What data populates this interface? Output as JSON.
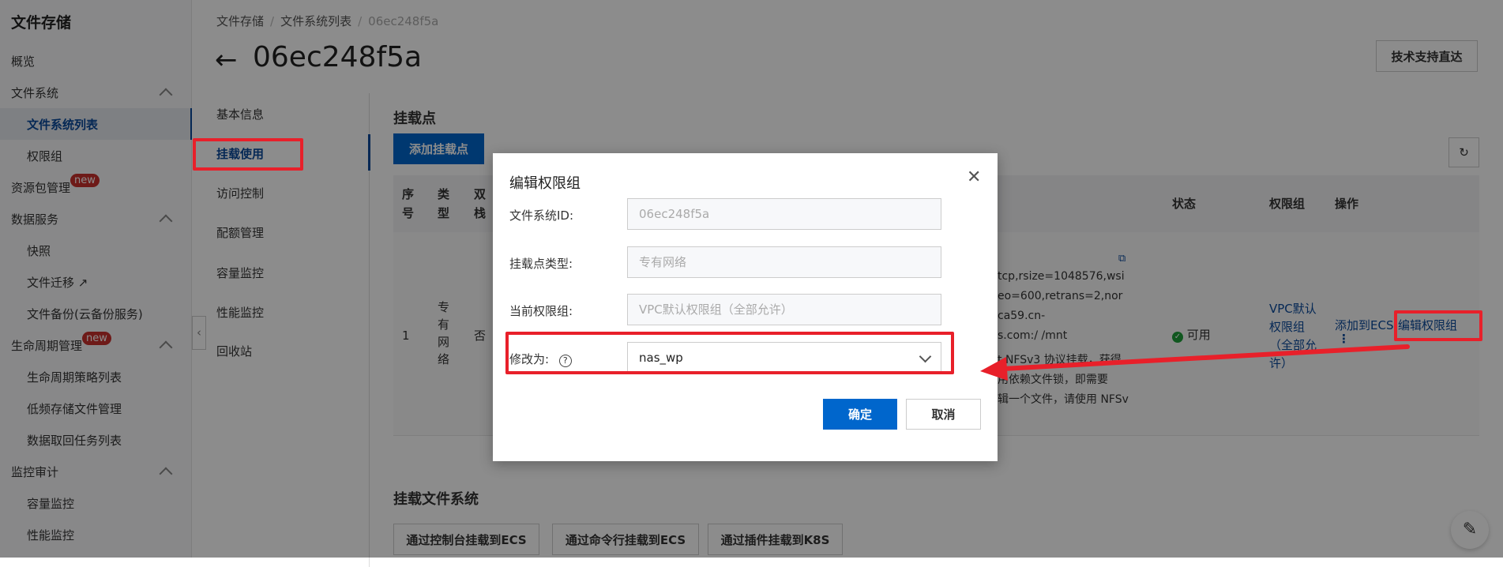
{
  "sidebar": {
    "title": "文件存储",
    "items": [
      {
        "label": "概览"
      },
      {
        "label": "文件系统"
      },
      {
        "label": "文件系统列表"
      },
      {
        "label": "权限组"
      },
      {
        "label": "资源包管理",
        "badge": "new"
      },
      {
        "label": "数据服务"
      },
      {
        "label": "快照"
      },
      {
        "label": "文件迁移"
      },
      {
        "label": "文件备份(云备份服务)"
      },
      {
        "label": "生命周期管理",
        "badge": "new"
      },
      {
        "label": "生命周期策略列表"
      },
      {
        "label": "低频存储文件管理"
      },
      {
        "label": "数据取回任务列表"
      },
      {
        "label": "监控审计"
      },
      {
        "label": "容量监控"
      },
      {
        "label": "性能监控"
      }
    ]
  },
  "breadcrumb": [
    "文件存储",
    "文件系统列表",
    "06ec248f5a"
  ],
  "header": {
    "title": "06ec248f5a",
    "support_button": "技术支持直达"
  },
  "subnav": [
    "基本信息",
    "挂载使用",
    "访问控制",
    "配额管理",
    "容量监控",
    "性能监控",
    "回收站"
  ],
  "mount": {
    "section_title": "挂载点",
    "add_button": "添加挂载点",
    "columns": [
      "序号",
      "类型",
      "双栈",
      "状态",
      "权限组",
      "操作"
    ],
    "row": {
      "index": "1",
      "type": "专有网络",
      "dual_stack": "否",
      "command_lines": [
        "tcp,rsize=1048576,wsi",
        "eo=600,retrans=2,nor",
        "ca59.cn-",
        "s.com:/ /mnt"
      ],
      "note_lines": [
        "t NFSv3 协议挂载，获得",
        "用依赖文件锁，即需要",
        "辑一个文件，请使用 NFSv"
      ],
      "status": "可用",
      "permission_group": "VPC默认权限组（全部允许）",
      "action_add": "添加到ECS",
      "action_edit": "编辑权限组"
    }
  },
  "mount_fs": {
    "title": "挂载文件系统",
    "buttons": [
      "通过控制台挂载到ECS",
      "通过命令行挂载到ECS",
      "通过插件挂载到K8S"
    ]
  },
  "dialog": {
    "title": "编辑权限组",
    "fields": [
      {
        "label": "文件系统ID:",
        "value": "06ec248f5a"
      },
      {
        "label": "挂载点类型:",
        "value": "专有网络"
      },
      {
        "label": "当前权限组:",
        "value": "VPC默认权限组（全部允许）"
      }
    ],
    "select_label": "修改为:",
    "select_value": "nas_wp",
    "confirm": "确定",
    "cancel": "取消"
  },
  "colors": {
    "primary": "#0066cc",
    "active_nav": "#0a4a9c",
    "annotation": "#e8202a",
    "status_ok": "#1e9e3a"
  }
}
